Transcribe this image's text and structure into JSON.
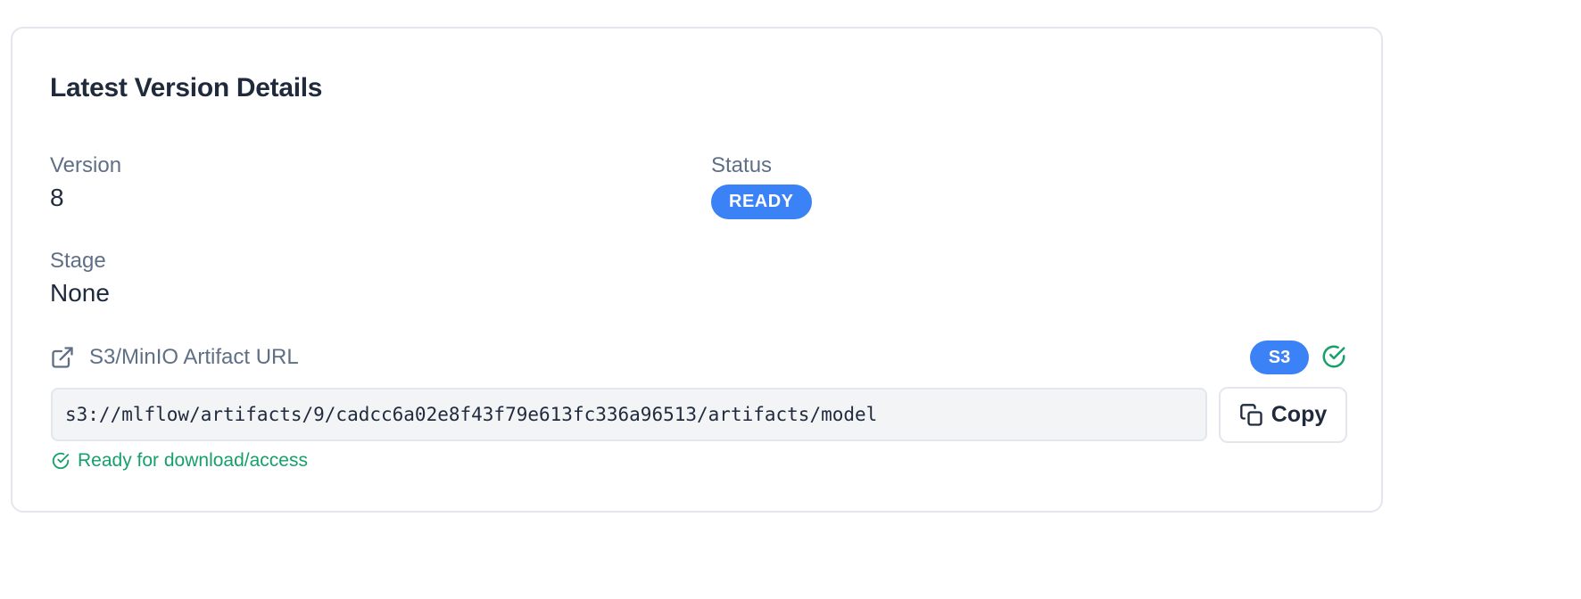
{
  "card": {
    "title": "Latest Version Details"
  },
  "fields": {
    "version": {
      "label": "Version",
      "value": "8"
    },
    "status": {
      "label": "Status",
      "value": "READY"
    },
    "stage": {
      "label": "Stage",
      "value": "None"
    }
  },
  "artifact": {
    "header_label": "S3/MinIO Artifact URL",
    "header_icon": "external-link-icon",
    "storage_badge": "S3",
    "verified_icon": "check-circle-icon",
    "url": "s3://mlflow/artifacts/9/cadcc6a02e8f43f79e613fc336a96513/artifacts/model",
    "copy_label": "Copy",
    "copy_icon": "copy-icon",
    "ready_message": "Ready for download/access"
  },
  "colors": {
    "accent": "#3b82f6",
    "success": "#16a06a",
    "text_primary": "#1f2a3d",
    "text_muted": "#5f6f85",
    "border": "#e3e7ed"
  }
}
